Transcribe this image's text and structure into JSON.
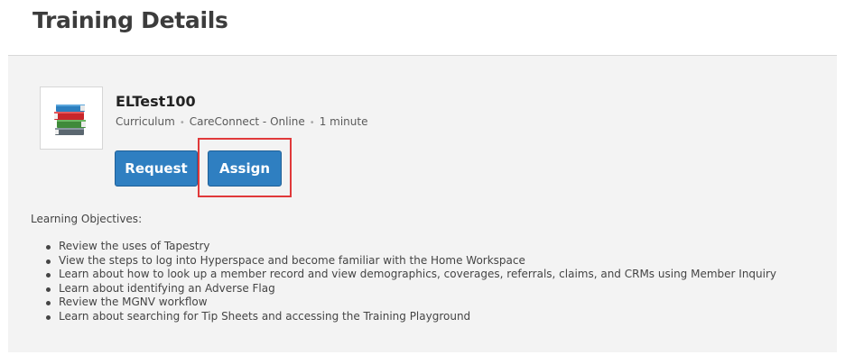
{
  "page": {
    "title": "Training Details"
  },
  "course": {
    "title": "ELTest100",
    "icon": "books-stack-icon",
    "meta": [
      "Curriculum",
      "CareConnect - Online",
      "1 minute"
    ]
  },
  "actions": {
    "request_label": "Request",
    "assign_label": "Assign"
  },
  "objectives": {
    "heading": "Learning Objectives:",
    "items": [
      "Review the uses of Tapestry",
      "View the steps to log into Hyperspace and become familiar with the Home Workspace",
      "Learn about how to look up a member record and view demographics, coverages, referrals, claims, and CRMs using Member Inquiry",
      "Learn about identifying an Adverse Flag",
      "Review the MGNV workflow",
      "Learn about searching for Tip Sheets and accessing the Training Playground"
    ]
  },
  "colors": {
    "button": "#2f7fc1",
    "highlight": "#e0393a",
    "panel": "#f3f3f3"
  }
}
